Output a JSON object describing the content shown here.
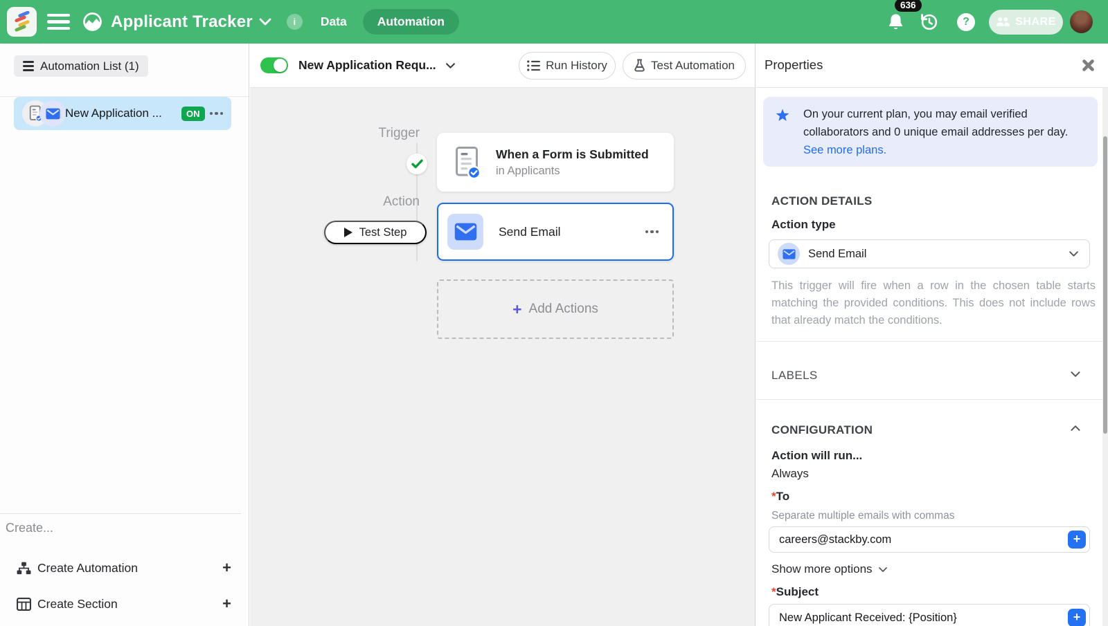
{
  "header": {
    "title": "Applicant Tracker",
    "tab_data": "Data",
    "tab_automation": "Automation",
    "notification_count": "636",
    "share_label": "SHARE"
  },
  "sidebar": {
    "list_header": "Automation List (1)",
    "item": {
      "label": "New Application ...",
      "status": "ON"
    },
    "create_title": "Create...",
    "create_automation": "Create Automation",
    "create_section": "Create Section"
  },
  "canvas": {
    "automation_name": "New Application Requ...",
    "run_history": "Run History",
    "test_automation": "Test Automation",
    "trigger_label": "Trigger",
    "action_label": "Action",
    "test_step": "Test Step",
    "trigger_card": {
      "title": "When a Form is Submitted",
      "subtitle": "in Applicants"
    },
    "action_card": {
      "title": "Send Email"
    },
    "add_actions": "Add Actions"
  },
  "properties": {
    "title": "Properties",
    "plan_notice_text": "On your current plan, you may email verified collaborators and 0 unique email addresses per day.",
    "plan_notice_link": "See more plans.",
    "action_details_heading": "ACTION DETAILS",
    "action_type_label": "Action type",
    "action_type_value": "Send Email",
    "action_description": "This trigger will fire when a row in the chosen table starts matching the provided conditions. This does not include rows that already match the conditions.",
    "labels_heading": "LABELS",
    "configuration_heading": "CONFIGURATION",
    "run_label": "Action will run...",
    "run_value": "Always",
    "required_marker": "*",
    "to_label": "To",
    "to_helper": "Separate multiple emails with commas",
    "to_value": "careers@stackby.com",
    "show_more": "Show more options",
    "subject_label": "Subject",
    "subject_value": "New Applicant Received: {Position}"
  },
  "colors": {
    "header_green": "#45b973",
    "active_tab_green": "#35a064",
    "toggle_green": "#2fc34d",
    "on_badge_green": "#0fa650",
    "accent_blue": "#2f6ff0",
    "selected_border_blue": "#1a6cf5",
    "plus_button_blue": "#2471f2",
    "link_blue": "#1f6cf2",
    "notice_bg": "#e9edfb",
    "add_plus_purple": "#5b58de",
    "canvas_bg": "#f0f0f1"
  }
}
